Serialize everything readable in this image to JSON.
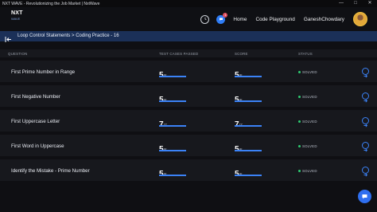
{
  "window": {
    "title": "NXT WAVE - Revolutionizing the Job Market | NxtWave",
    "controls": [
      "—",
      "□",
      "✕"
    ]
  },
  "navbar": {
    "logo_main": "NXT",
    "logo_sub": "WAVE",
    "notification_count": "1",
    "links": [
      "Home",
      "Code Playground",
      "GaneshChowdary"
    ]
  },
  "breadcrumb": {
    "text": "Loop Control Statements > Coding Practice - 16"
  },
  "table": {
    "headers": [
      "QUESTION",
      "TEST CASES PASSED",
      "SCORE",
      "STATUS"
    ],
    "rows": [
      {
        "question": "First Prime Number in Range",
        "passed": "5",
        "passed_total": "/5",
        "score": "5",
        "score_total": "/5",
        "status": "SOLVED",
        "progress": 1.0
      },
      {
        "question": "First Negative Number",
        "passed": "5",
        "passed_total": "/5",
        "score": "5",
        "score_total": "/5",
        "status": "SOLVED",
        "progress": 1.0
      },
      {
        "question": "First Uppercase Letter",
        "passed": "7",
        "passed_total": "/7",
        "score": "7",
        "score_total": "/7",
        "status": "SOLVED",
        "progress": 1.0
      },
      {
        "question": "First Word in Uppercase",
        "passed": "5",
        "passed_total": "/5",
        "score": "5",
        "score_total": "/5",
        "status": "SOLVED",
        "progress": 1.0
      },
      {
        "question": "Identify the Mistake - Prime Number",
        "passed": "5",
        "passed_total": "/5",
        "score": "5",
        "score_total": "/5",
        "status": "SOLVED",
        "progress": 1.0
      }
    ]
  },
  "colors": {
    "accent": "#3b82f6",
    "solved": "#2ecc71",
    "breadcrumb_bg": "#1b3058"
  }
}
